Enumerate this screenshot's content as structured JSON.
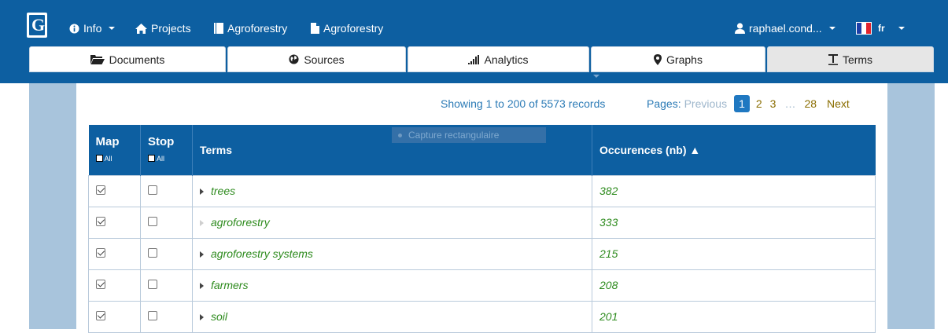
{
  "navbar": {
    "logo_letter": "G",
    "info_label": "Info",
    "projects_label": "Projects",
    "corpus_label": "Agroforestry",
    "doc_label": "Agroforestry",
    "user_label": "raphael.cond...",
    "lang_label": "fr"
  },
  "tabs": [
    {
      "label": "Documents",
      "icon": "folder-open-icon"
    },
    {
      "label": "Sources",
      "icon": "globe-icon"
    },
    {
      "label": "Analytics",
      "icon": "signal-bars-icon"
    },
    {
      "label": "Graphs",
      "icon": "map-marker-icon"
    },
    {
      "label": "Terms",
      "icon": "text-icon",
      "active": true
    }
  ],
  "pager": {
    "showing": "Showing 1 to 200 of 5573 records",
    "pages_label": "Pages:",
    "previous": "Previous",
    "pages": [
      "1",
      "2",
      "3"
    ],
    "ellipsis": "…",
    "last": "28",
    "next": "Next"
  },
  "ghost_tooltip": "Capture rectangulaire",
  "table": {
    "headers": {
      "map": "Map",
      "stop": "Stop",
      "all": "All",
      "terms": "Terms",
      "occurrences": "Occurences (nb) ▲"
    },
    "rows": [
      {
        "map": true,
        "stop": false,
        "term": "trees",
        "occ": "382",
        "expand": "dark"
      },
      {
        "map": true,
        "stop": false,
        "term": "agroforestry",
        "occ": "333",
        "expand": "light"
      },
      {
        "map": true,
        "stop": false,
        "term": "agroforestry systems",
        "occ": "215",
        "expand": "dark"
      },
      {
        "map": true,
        "stop": false,
        "term": "farmers",
        "occ": "208",
        "expand": "dark"
      },
      {
        "map": true,
        "stop": false,
        "term": "soil",
        "occ": "201",
        "expand": "dark"
      }
    ]
  },
  "colors": {
    "brand": "#0d5fa1",
    "side_panel": "#a8c4dc",
    "term_green": "#2e8b1e",
    "pager_link": "#8a6d00"
  }
}
